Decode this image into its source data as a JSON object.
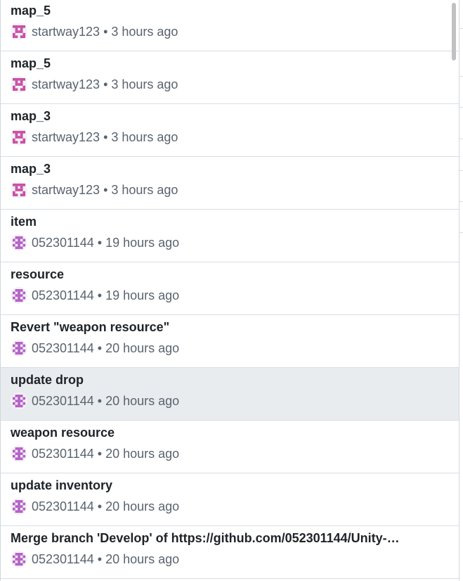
{
  "commits": [
    {
      "message": "map_5",
      "author": "startway123",
      "time": "3 hours ago",
      "avatar": "pink-identicon",
      "selected": false
    },
    {
      "message": "map_5",
      "author": "startway123",
      "time": "3 hours ago",
      "avatar": "pink-identicon",
      "selected": false
    },
    {
      "message": "map_3",
      "author": "startway123",
      "time": "3 hours ago",
      "avatar": "pink-identicon",
      "selected": false
    },
    {
      "message": "map_3",
      "author": "startway123",
      "time": "3 hours ago",
      "avatar": "pink-identicon",
      "selected": false
    },
    {
      "message": "item",
      "author": "052301144",
      "time": "19 hours ago",
      "avatar": "purple-identicon",
      "selected": false
    },
    {
      "message": "resource",
      "author": "052301144",
      "time": "19 hours ago",
      "avatar": "purple-identicon",
      "selected": false
    },
    {
      "message": "Revert \"weapon resource\"",
      "author": "052301144",
      "time": "20 hours ago",
      "avatar": "purple-identicon",
      "selected": false
    },
    {
      "message": "update drop",
      "author": "052301144",
      "time": "20 hours ago",
      "avatar": "purple-identicon",
      "selected": true
    },
    {
      "message": "weapon resource",
      "author": "052301144",
      "time": "20 hours ago",
      "avatar": "purple-identicon",
      "selected": false
    },
    {
      "message": "update inventory",
      "author": "052301144",
      "time": "20 hours ago",
      "avatar": "purple-identicon",
      "selected": false
    },
    {
      "message": "Merge branch 'Develop' of https://github.com/052301144/Unity-…",
      "author": "052301144",
      "time": "20 hours ago",
      "avatar": "purple-identicon",
      "selected": false
    }
  ],
  "separator": "•",
  "colors": {
    "pink_identicon": "#c94fa8",
    "purple_identicon": "#b55fc8",
    "selected_row": "#e9ecef",
    "title_text": "#1f2328",
    "meta_text": "#59636e"
  }
}
